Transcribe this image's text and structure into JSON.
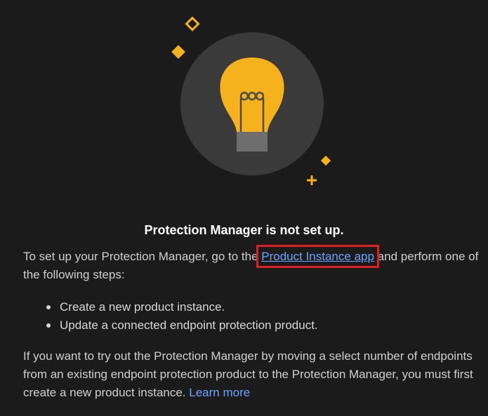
{
  "colors": {
    "background": "#1b1b1b",
    "circle": "#3a3a3a",
    "accent": "#f5b21d",
    "link": "#6aa3ff",
    "highlight": "#e02020"
  },
  "illustration": {
    "icon": "lightbulb-icon"
  },
  "content": {
    "title": "Protection Manager is not set up.",
    "intro_before": "To set up your Protection Manager, go to the ",
    "app_link": "Product Instance app",
    "intro_after": " and perform one of the following steps:",
    "steps": [
      "Create a new product instance.",
      "Update a connected endpoint protection product."
    ],
    "more_text": "If you want to try out the Protection Manager by moving a select number of endpoints from an existing endpoint protection product to the Protection Manager, you must first create a new product instance. ",
    "learn_more": "Learn more"
  }
}
